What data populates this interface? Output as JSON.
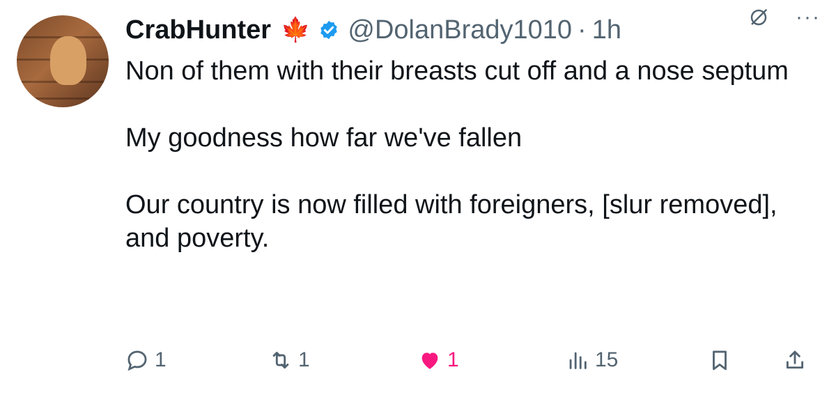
{
  "author": {
    "name": "CrabHunter",
    "handle": "@DolanBrady1010",
    "time": "1h",
    "badge_emoji": "🍁"
  },
  "tweet": {
    "paragraphs": [
      "Non of them with their breasts cut off and a nose septum",
      "My goodness how far we've fallen",
      "Our country is now filled with foreigners, [slur removed], and poverty."
    ]
  },
  "actions": {
    "replies": "1",
    "retweets": "1",
    "likes": "1",
    "views": "15"
  },
  "icons": [
    "grok-icon",
    "more-icon",
    "reply-icon",
    "retweet-icon",
    "heart-icon",
    "views-icon",
    "bookmark-icon",
    "share-icon",
    "verified-icon"
  ],
  "colors": {
    "verified": "#1d9bf0",
    "like": "#f91880",
    "secondary": "#536471"
  }
}
